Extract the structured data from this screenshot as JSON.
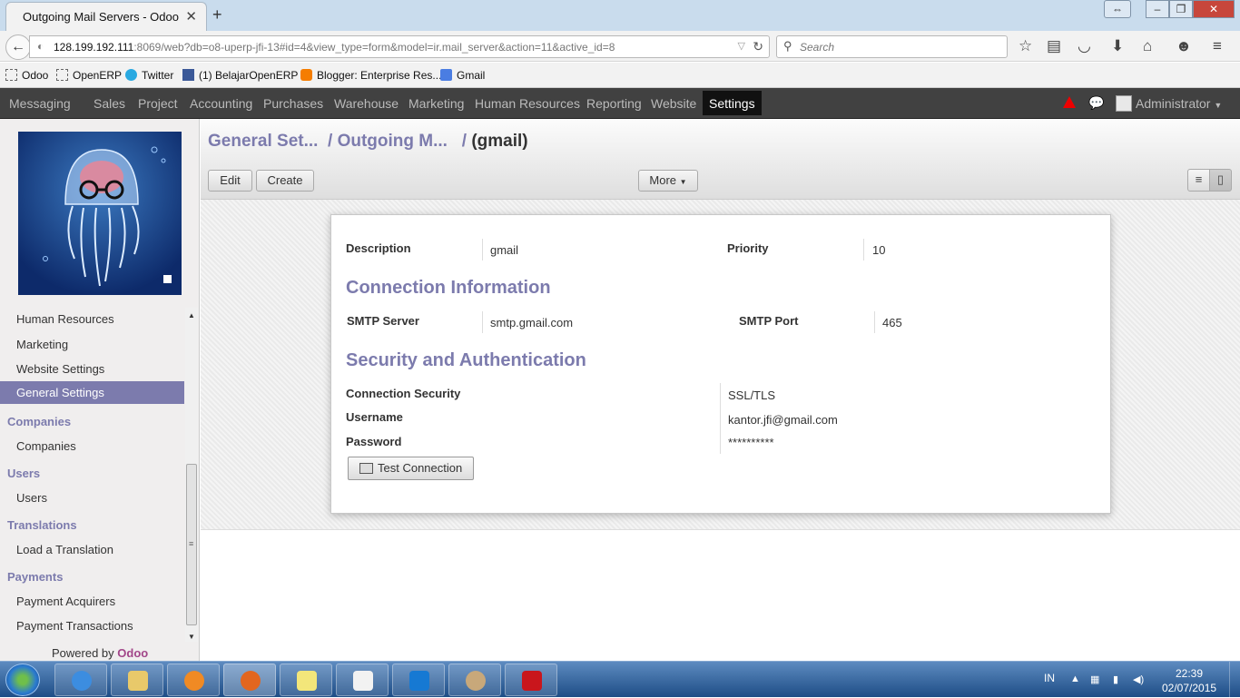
{
  "browser": {
    "tab_title": "Outgoing Mail Servers - Odoo",
    "url_host": "128.199.192.111",
    "url_rest": ":8069/web?db=o8-uperp-jfi-13#id=4&view_type=form&model=ir.mail_server&action=11&active_id=8",
    "search_placeholder": "Search",
    "bookmarks": [
      {
        "label": "Odoo",
        "icon": "page-icon"
      },
      {
        "label": "OpenERP",
        "icon": "page-icon"
      },
      {
        "label": "Twitter",
        "icon": "twitter-icon"
      },
      {
        "label": "(1) BelajarOpenERP",
        "icon": "facebook-icon"
      },
      {
        "label": "Blogger: Enterprise Res...",
        "icon": "blogger-icon"
      },
      {
        "label": "Gmail",
        "icon": "google-icon"
      }
    ]
  },
  "topmenu": {
    "items": [
      "Messaging",
      "Sales",
      "Project",
      "Accounting",
      "Purchases",
      "Warehouse",
      "Marketing",
      "Human Resources",
      "Reporting",
      "Website",
      "Settings"
    ],
    "active": "Settings",
    "user": "Administrator"
  },
  "sidebar": {
    "items_top": [
      "Human Resources",
      "Marketing",
      "Website Settings"
    ],
    "active": "General Settings",
    "groups": [
      {
        "header": "Companies",
        "items": [
          "Companies"
        ]
      },
      {
        "header": "Users",
        "items": [
          "Users"
        ]
      },
      {
        "header": "Translations",
        "items": [
          "Load a Translation"
        ]
      },
      {
        "header": "Payments",
        "items": [
          "Payment Acquirers",
          "Payment Transactions"
        ]
      }
    ],
    "powered_prefix": "Powered by",
    "powered_brand": "Odoo"
  },
  "breadcrumb": {
    "part1": "General Set...",
    "part2": "Outgoing M...",
    "current": "(gmail)"
  },
  "buttons": {
    "edit": "Edit",
    "create": "Create",
    "more": "More"
  },
  "form": {
    "description_label": "Description",
    "description": "gmail",
    "priority_label": "Priority",
    "priority": "10",
    "section_connection": "Connection Information",
    "smtp_server_label": "SMTP Server",
    "smtp_server": "smtp.gmail.com",
    "smtp_port_label": "SMTP Port",
    "smtp_port": "465",
    "section_security": "Security and Authentication",
    "connection_security_label": "Connection Security",
    "connection_security": "SSL/TLS",
    "username_label": "Username",
    "username": "kantor.jfi@gmail.com",
    "password_label": "Password",
    "password": "**********",
    "test_connection": "Test Connection"
  },
  "taskbar": {
    "language": "IN",
    "time": "22:39",
    "date": "02/07/2015",
    "apps": [
      "internet-explorer-icon",
      "file-explorer-icon",
      "media-player-icon",
      "firefox-icon",
      "notes-icon",
      "reader-icon",
      "teamviewer-icon",
      "paint-icon",
      "acrobat-icon"
    ]
  },
  "colors": {
    "accent": "#7c7bad",
    "topmenu_bg": "#414141",
    "brand": "#a24689"
  }
}
